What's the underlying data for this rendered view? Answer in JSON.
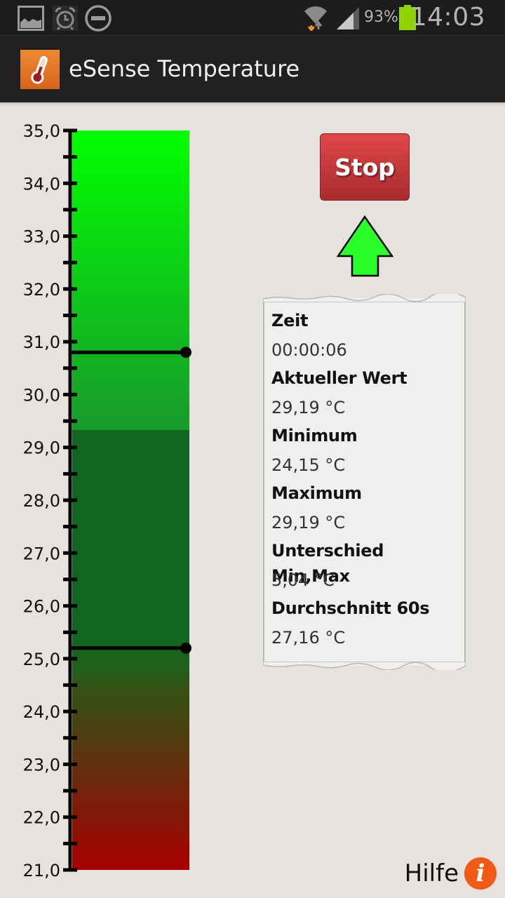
{
  "status_bar": {
    "left_icons": [
      "gallery-icon",
      "alarm-icon",
      "do-not-disturb-icon"
    ],
    "right_icons": [
      "wifi-icon",
      "signal-icon",
      "battery-icon"
    ],
    "battery_percent": "93%",
    "battery_level": 0.93,
    "time": "14:03",
    "battery_color": "#8fd400"
  },
  "app_bar": {
    "title": "eSense Temperature",
    "icon": "thermometer-icon",
    "icon_color": "#e0732a"
  },
  "controls": {
    "stop_label": "Stop",
    "trend": "up",
    "trend_color": "#2bff2b",
    "help_label": "Hilfe",
    "help_icon": "info-icon",
    "help_icon_color": "#f05a16"
  },
  "stats": [
    {
      "label": "Zeit",
      "value": "00:00:06"
    },
    {
      "label": "Aktueller Wert",
      "value": "29,19 °C"
    },
    {
      "label": "Minimum",
      "value": "24,15 °C"
    },
    {
      "label": "Maximum",
      "value": "29,19 °C"
    },
    {
      "label": "Unterschied Min,Max",
      "value": "5,04 °C"
    },
    {
      "label": "Durchschnitt 60s",
      "value": "27,16 °C"
    }
  ],
  "chart_data": {
    "type": "bar",
    "title": "",
    "orientation": "vertical-gauge",
    "ylim": [
      21.0,
      35.0
    ],
    "major_ticks": [
      "21,0",
      "22,0",
      "23,0",
      "24,0",
      "25,0",
      "26,0",
      "27,0",
      "28,0",
      "29,0",
      "30,0",
      "31,0",
      "32,0",
      "33,0",
      "34,0",
      "35,0"
    ],
    "minor_tick_step": 0.5,
    "current_value": 29.33,
    "marker_lines": [
      30.8,
      25.2
    ],
    "gradient_colors": {
      "top": "#00ff00",
      "middle": "#17a02a",
      "lower": "#3c4a14",
      "bottom": "#a80000"
    },
    "below_value_shade": "#10661e",
    "xlabel": "",
    "ylabel": ""
  }
}
